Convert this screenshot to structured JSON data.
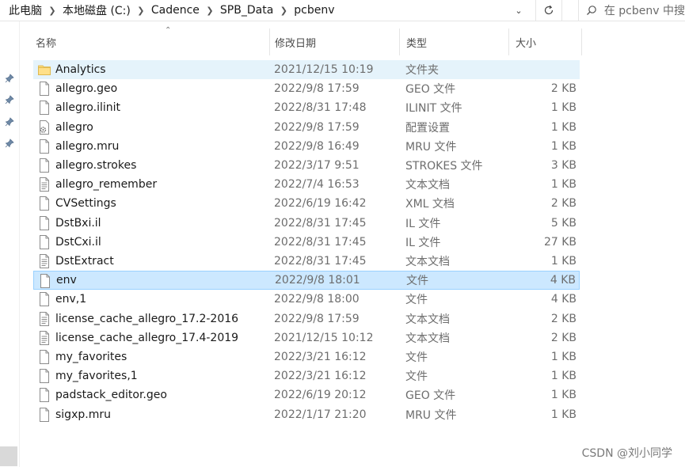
{
  "address_bar": {
    "crumbs": [
      "此电脑",
      "本地磁盘 (C:)",
      "Cadence",
      "SPB_Data",
      "pcbenv"
    ]
  },
  "search": {
    "placeholder": "在 pcbenv 中搜"
  },
  "columns": {
    "name": "名称",
    "date": "修改日期",
    "type": "类型",
    "size": "大小"
  },
  "files": [
    {
      "name": "Analytics",
      "date": "2021/12/15 10:19",
      "type": "文件夹",
      "size": "",
      "icon": "folder-icon"
    },
    {
      "name": "allegro.geo",
      "date": "2022/9/8 17:59",
      "type": "GEO 文件",
      "size": "2 KB",
      "icon": "file-icon"
    },
    {
      "name": "allegro.ilinit",
      "date": "2022/8/31 17:48",
      "type": "ILINIT 文件",
      "size": "1 KB",
      "icon": "file-icon"
    },
    {
      "name": "allegro",
      "date": "2022/9/8 17:59",
      "type": "配置设置",
      "size": "1 KB",
      "icon": "config-file-icon"
    },
    {
      "name": "allegro.mru",
      "date": "2022/9/8 16:49",
      "type": "MRU 文件",
      "size": "1 KB",
      "icon": "file-icon"
    },
    {
      "name": "allegro.strokes",
      "date": "2022/3/17 9:51",
      "type": "STROKES 文件",
      "size": "3 KB",
      "icon": "file-icon"
    },
    {
      "name": "allegro_remember",
      "date": "2022/7/4 16:53",
      "type": "文本文档",
      "size": "1 KB",
      "icon": "text-file-icon"
    },
    {
      "name": "CVSettings",
      "date": "2022/6/19 16:42",
      "type": "XML 文档",
      "size": "2 KB",
      "icon": "file-icon"
    },
    {
      "name": "DstBxi.il",
      "date": "2022/8/31 17:45",
      "type": "IL 文件",
      "size": "5 KB",
      "icon": "file-icon"
    },
    {
      "name": "DstCxi.il",
      "date": "2022/8/31 17:45",
      "type": "IL 文件",
      "size": "27 KB",
      "icon": "file-icon"
    },
    {
      "name": "DstExtract",
      "date": "2022/8/31 17:45",
      "type": "文本文档",
      "size": "1 KB",
      "icon": "text-file-icon"
    },
    {
      "name": "env",
      "date": "2022/9/8 18:01",
      "type": "文件",
      "size": "4 KB",
      "icon": "file-icon"
    },
    {
      "name": "env,1",
      "date": "2022/9/8 18:00",
      "type": "文件",
      "size": "4 KB",
      "icon": "file-icon"
    },
    {
      "name": "license_cache_allegro_17.2-2016",
      "date": "2022/9/8 17:59",
      "type": "文本文档",
      "size": "2 KB",
      "icon": "text-file-icon"
    },
    {
      "name": "license_cache_allegro_17.4-2019",
      "date": "2021/12/15 10:12",
      "type": "文本文档",
      "size": "2 KB",
      "icon": "text-file-icon"
    },
    {
      "name": "my_favorites",
      "date": "2022/3/21 16:12",
      "type": "文件",
      "size": "1 KB",
      "icon": "file-icon"
    },
    {
      "name": "my_favorites,1",
      "date": "2022/3/21 16:12",
      "type": "文件",
      "size": "1 KB",
      "icon": "file-icon"
    },
    {
      "name": "padstack_editor.geo",
      "date": "2022/6/19 20:12",
      "type": "GEO 文件",
      "size": "1 KB",
      "icon": "file-icon"
    },
    {
      "name": "sigxp.mru",
      "date": "2022/1/17 21:20",
      "type": "MRU 文件",
      "size": "1 KB",
      "icon": "file-icon"
    }
  ],
  "hovered_row": 0,
  "selected_row": 11,
  "watermark": "CSDN @刘小同学",
  "colors": {
    "hover": "#e5f3fb",
    "selected": "#cce8ff",
    "selected_border": "#99d1ff",
    "folder": "#f8d775"
  }
}
